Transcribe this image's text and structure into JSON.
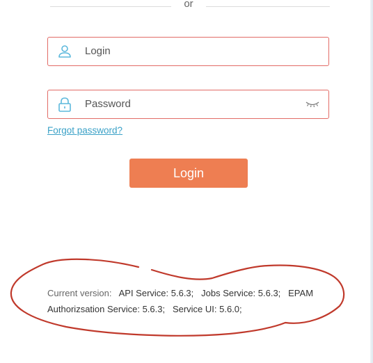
{
  "divider": {
    "text": "or"
  },
  "login_field": {
    "placeholder": "Login",
    "icon": "user-icon"
  },
  "password_field": {
    "placeholder": "Password",
    "icon": "lock-icon",
    "toggle_icon": "eye-closed-icon"
  },
  "forgot_password": {
    "label": "Forgot password?"
  },
  "login_button": {
    "label": "Login"
  },
  "version_info": {
    "label": "Current version:",
    "api_service": "API Service: 5.6.3;",
    "jobs_service": "Jobs Service: 5.6.3;",
    "auth_service": "EPAM Authorizsation Service: 5.6.3;",
    "service_ui": "Service UI: 5.6.0;"
  },
  "colors": {
    "field_border": "#e26b66",
    "icon": "#5cb8dc",
    "link": "#3aa1c7",
    "button": "#ee7e52",
    "annotation": "#c0392b"
  }
}
